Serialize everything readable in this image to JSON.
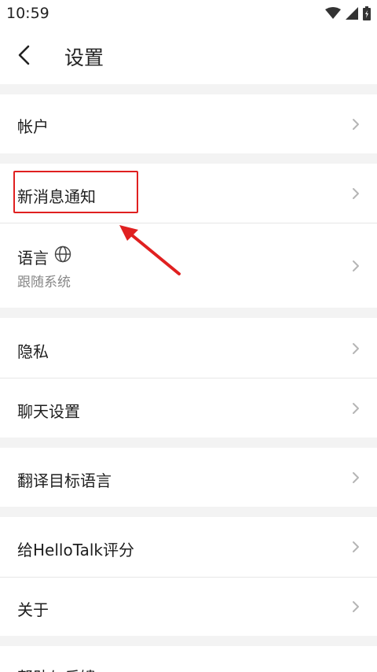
{
  "status_bar": {
    "time": "10:59",
    "icons": [
      "wifi-icon",
      "signal-icon",
      "battery-icon"
    ]
  },
  "header": {
    "back_icon": "chevron-left-icon",
    "title": "设置"
  },
  "settings": {
    "account": "帐户",
    "notifications": "新消息通知",
    "language": "语言",
    "language_icon": "globe-icon",
    "language_value": "跟随系统",
    "privacy": "隐私",
    "chat_settings": "聊天设置",
    "translate_target": "翻译目标语言",
    "rate_app": "给HelloTalk评分",
    "about": "关于",
    "help_feedback": "帮助与反馈"
  },
  "annotation": {
    "highlight_color": "#e02020"
  },
  "colors": {
    "separator": "#f3f3f3",
    "chevron": "#b5b5b5",
    "secondary_text": "#888888"
  }
}
